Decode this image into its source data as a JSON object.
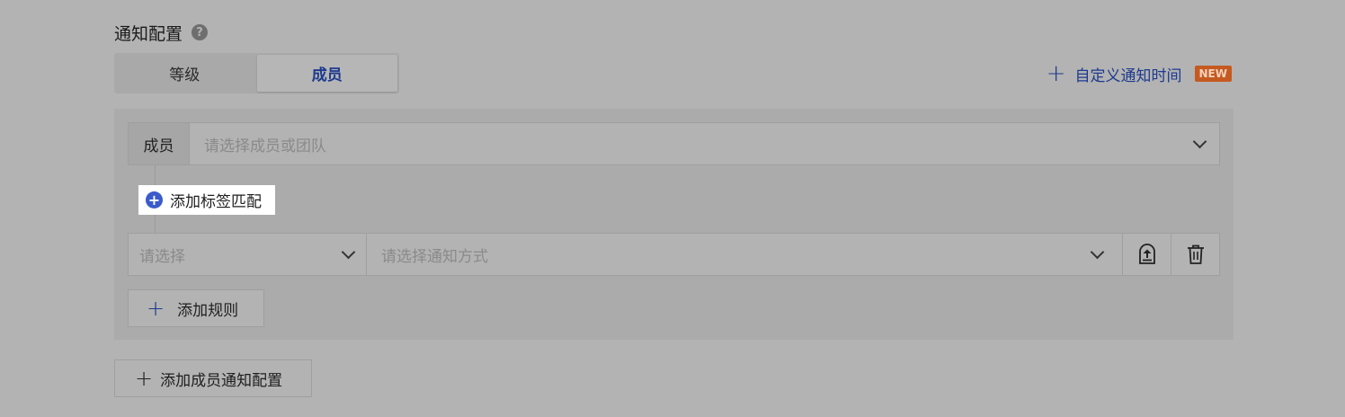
{
  "section": {
    "title": "通知配置",
    "help_glyph": "?"
  },
  "tabs": [
    {
      "label": "等级",
      "active": false
    },
    {
      "label": "成员",
      "active": true
    }
  ],
  "custom_time": {
    "plus": "+",
    "label": "自定义通知时间",
    "badge": "NEW"
  },
  "member_row": {
    "tag": "成员",
    "placeholder": "请选择成员或团队"
  },
  "add_tag_match": {
    "glyph": "+",
    "label": "添加标签匹配"
  },
  "rule_row": {
    "level_placeholder": "请选择",
    "method_placeholder": "请选择通知方式",
    "icons": [
      "move-top-icon",
      "trash-icon"
    ]
  },
  "add_rule": {
    "plus": "+",
    "label": "添加规则"
  },
  "add_member_config": {
    "plus": "+",
    "label": "添加成员通知配置"
  },
  "colors": {
    "accent": "#1d3a8f",
    "badge": "#c55a21",
    "plus_circle": "#3b5bcc",
    "overlay_bg": "#b3b3b3"
  }
}
